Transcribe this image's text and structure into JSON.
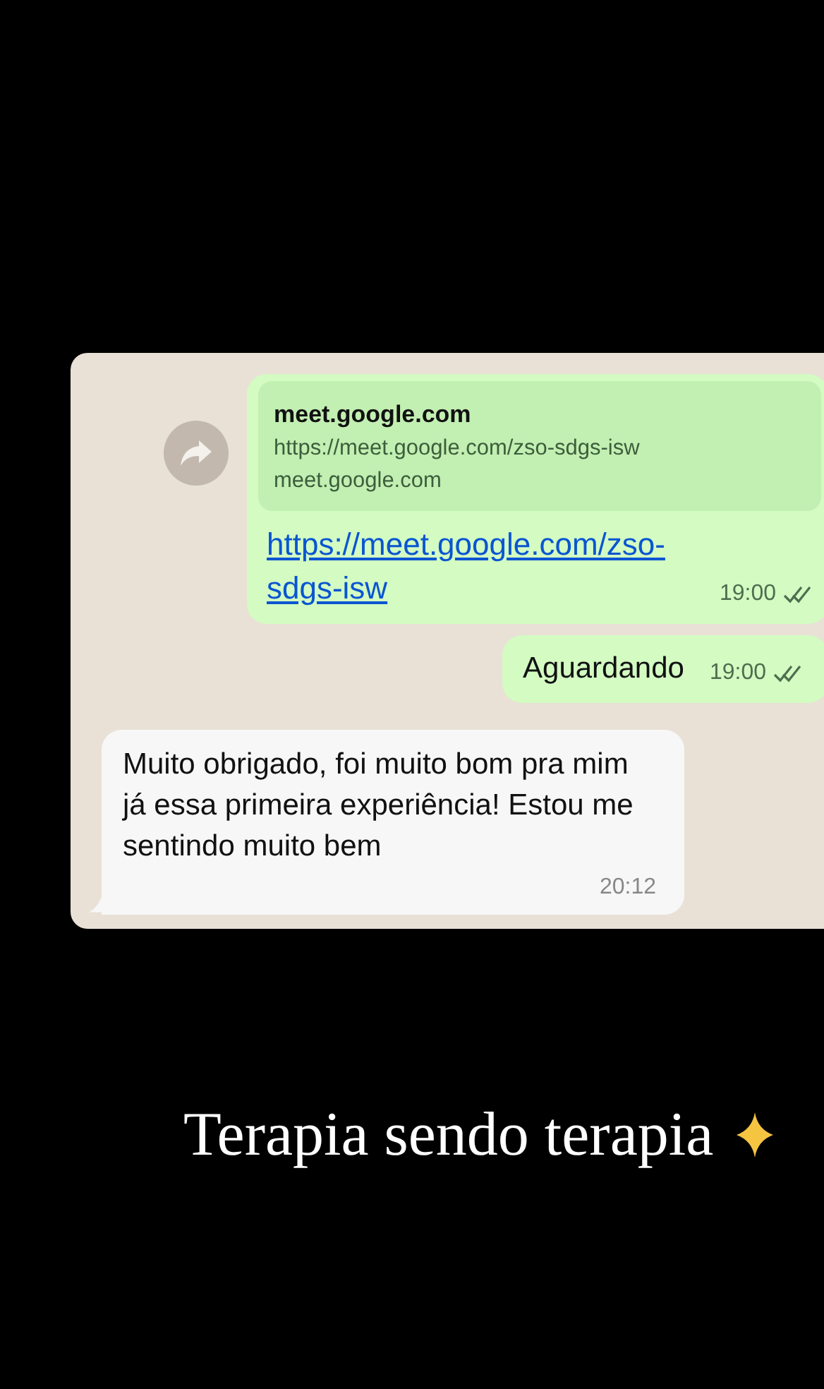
{
  "chat": {
    "messages": [
      {
        "kind": "link",
        "outgoing": true,
        "forwardable": true,
        "preview": {
          "title": "meet.google.com",
          "url": "https://meet.google.com/zso-sdgs-isw",
          "domain": "meet.google.com"
        },
        "text": "https://meet.google.com/zso-sdgs-isw",
        "time": "19:00",
        "read": false
      },
      {
        "kind": "text",
        "outgoing": true,
        "forwardable": false,
        "text": "Aguardando",
        "time": "19:00",
        "read": false
      },
      {
        "kind": "text",
        "outgoing": false,
        "forwardable": false,
        "text": "Muito obrigado, foi muito bom pra mim já essa primeira experiência! Estou me sentindo muito bem",
        "time": "20:12"
      }
    ]
  },
  "caption": {
    "text": "Terapia sendo terapia"
  }
}
